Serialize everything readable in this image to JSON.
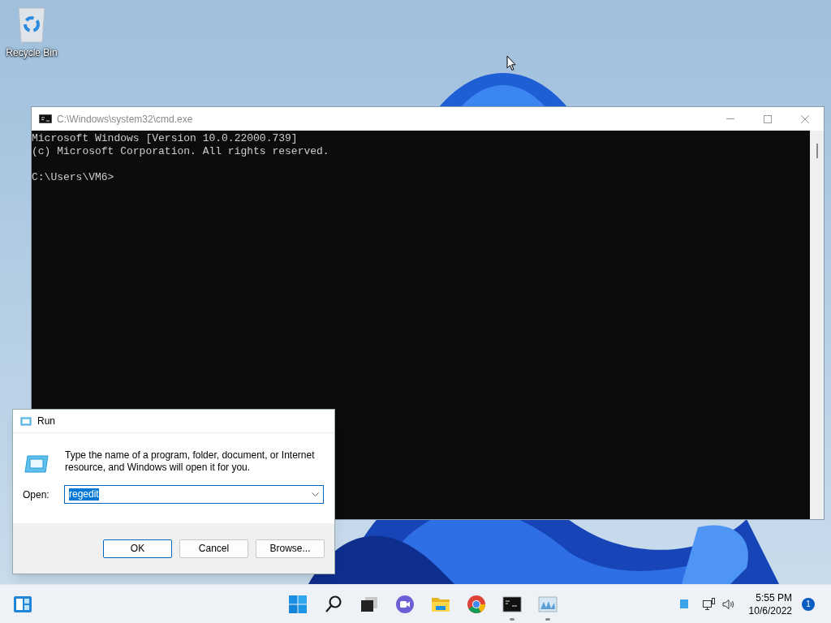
{
  "desktop_icons": [
    {
      "label": "Recycle Bin"
    }
  ],
  "cmd_window": {
    "title": "C:\\Windows\\system32\\cmd.exe",
    "lines": [
      "Microsoft Windows [Version 10.0.22000.739]",
      "(c) Microsoft Corporation. All rights reserved."
    ],
    "prompt": "C:\\Users\\VM6>"
  },
  "run_dialog": {
    "title": "Run",
    "message": "Type the name of a program, folder, document, or Internet resource, and Windows will open it for you.",
    "open_label": "Open:",
    "value": "regedit",
    "value_selected": true,
    "buttons": [
      {
        "label": "OK",
        "default": true
      },
      {
        "label": "Cancel",
        "default": false
      },
      {
        "label": "Browse...",
        "default": false
      }
    ]
  },
  "taskbar": {
    "apps": [
      {
        "kind": "start",
        "running": false
      },
      {
        "kind": "search",
        "running": false
      },
      {
        "kind": "taskview",
        "running": false
      },
      {
        "kind": "chat",
        "running": false
      },
      {
        "kind": "explorer",
        "running": false
      },
      {
        "kind": "chrome",
        "running": false
      },
      {
        "kind": "terminal",
        "running": true
      },
      {
        "kind": "monitor",
        "running": true
      }
    ],
    "time": "5:55 PM",
    "date": "10/6/2022",
    "notifications": "1"
  }
}
